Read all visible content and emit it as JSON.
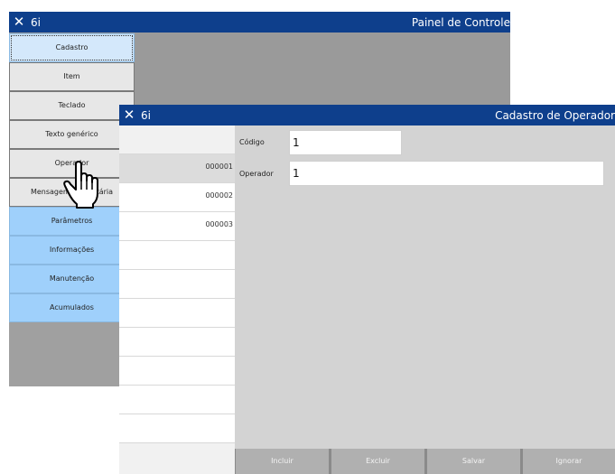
{
  "panel": {
    "app_name": "6i",
    "title": "Painel de Controle",
    "menu": [
      {
        "label": "Cadastro",
        "style": "sel"
      },
      {
        "label": "Item",
        "style": "gray"
      },
      {
        "label": "Teclado",
        "style": "gray"
      },
      {
        "label": "Texto genérico",
        "style": "gray"
      },
      {
        "label": "Operador",
        "style": "gray"
      },
      {
        "label": "Mensagem publicitária",
        "style": "gray"
      },
      {
        "label": "Parâmetros",
        "style": "blue"
      },
      {
        "label": "Informações",
        "style": "blue"
      },
      {
        "label": "Manutenção",
        "style": "blue"
      },
      {
        "label": "Acumulados",
        "style": "blue"
      }
    ]
  },
  "cadastro": {
    "app_name": "6i",
    "title": "Cadastro de Operador",
    "list": [
      "000001",
      "000002",
      "000003"
    ],
    "fields": {
      "codigo_label": "Código",
      "codigo_value": "1",
      "operador_label": "Operador",
      "operador_value": "1"
    },
    "buttons": {
      "incluir": "Incluir",
      "excluir": "Excluir",
      "salvar": "Salvar",
      "ignorar": "Ignorar"
    }
  },
  "colors": {
    "titlebar": "#0e3f8c",
    "menu_blue": "#9fd0fb",
    "menu_gray": "#e7e7e7"
  }
}
